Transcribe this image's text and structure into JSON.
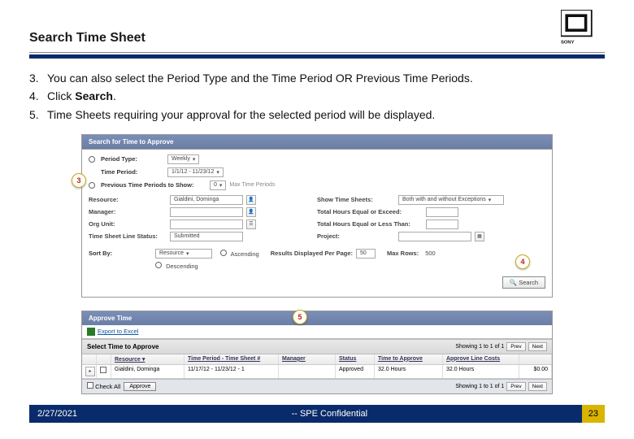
{
  "page": {
    "title": "Search Time Sheet",
    "footer_date": "2/27/2021",
    "footer_confidential": "-- SPE Confidential",
    "page_number": "23"
  },
  "instructions": {
    "item3_num": "3",
    "item3": "You can also select the Period Type and the Time Period OR Previous Time Periods.",
    "item4_num": "4",
    "item4_pre": "Click ",
    "item4_bold": "Search",
    "item4_post": ".",
    "item5_num": "5",
    "item5": "Time Sheets requiring your approval for the selected period will be displayed."
  },
  "callouts": {
    "c3": "3",
    "c4": "4",
    "c5": "5"
  },
  "panel1": {
    "header": "Search for Time to Approve",
    "period_type_label": "Period Type:",
    "period_type_value": "Weekly",
    "time_period_label": "Time Period:",
    "time_period_value": "1/1/12 - 11/23/12",
    "prev_label": "Previous Time Periods to Show:",
    "prev_value": "0",
    "prev_suffix": "Max Time Periods",
    "left": {
      "resource_label": "Resource:",
      "resource_value": "Gialdini, Dominga",
      "manager_label": "Manager:",
      "manager_value": "",
      "org_label": "Org Unit:",
      "org_value": "",
      "tsls_label": "Time Sheet Line Status:",
      "tsls_value": "Submitted"
    },
    "right": {
      "show_label": "Show Time Sheets:",
      "show_value": "Both with and without Exceptions",
      "hours_ge_label": "Total Hours Equal or Exceed:",
      "hours_ge_value": "",
      "hours_le_label": "Total Hours Equal or Less Than:",
      "hours_le_value": "",
      "project_label": "Project:",
      "project_value": ""
    },
    "sort": {
      "label": "Sort By:",
      "value": "Resource",
      "asc": "Ascending",
      "desc": "Descending",
      "results_label": "Results Displayed Per Page:",
      "results_value": "50",
      "max_rows_label": "Max Rows:",
      "max_rows_value": "500"
    },
    "search_btn": "Search"
  },
  "panel2": {
    "header": "Approve Time",
    "export": "Export to Excel",
    "subheader": "Select Time to Approve",
    "showing": "Showing 1 to 1 of 1",
    "prev": "Prev",
    "next": "Next",
    "cols": {
      "resource": "Resource ▾",
      "tp": "Time Period - Time Sheet #",
      "manager": "Manager",
      "status": "Status",
      "tta": "Time to Approve",
      "atl": "Approve Line Costs"
    },
    "row": {
      "resource": "Gialdini, Dominga",
      "tp": "11/17/12 - 11/23/12 - 1",
      "manager": "",
      "status": "Approved",
      "tta": "32.0 Hours",
      "atl1": "32.0 Hours",
      "atl2": "$0.00"
    },
    "foot": {
      "checkall": "Check All",
      "approve": "Approve",
      "showing": "Showing 1 to 1 of 1"
    }
  }
}
